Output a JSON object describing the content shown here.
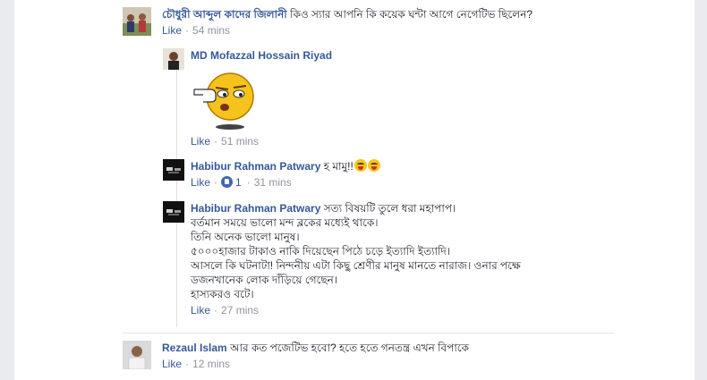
{
  "comments": [
    {
      "author": "চৌধুরী আব্দুল কাদের জিলানী",
      "text": "কিও স্যার আপনি কি কয়েক ঘন্টা আগে নেগেটিভ ছিলেন?",
      "like_label": "Like",
      "time": "54 mins"
    },
    {
      "author": "MD Mofazzal Hossain Riyad",
      "sticker": "thinking-emoji-sticker",
      "like_label": "Like",
      "time": "51 mins"
    },
    {
      "author": "Habibur Rahman Patwary",
      "text": "হ মামু!!",
      "emojis": [
        "grinning-tongue-emoji",
        "grinning-tongue-emoji"
      ],
      "like_label": "Like",
      "reaction_icon": "like-reaction-icon",
      "reaction_count": "1",
      "time": "31 mins"
    },
    {
      "author": "Habibur Rahman Patwary",
      "lines": [
        "সত্য বিষয়টি তুলে ধরা মহাপাপ।",
        "বর্তমান সময়ে ভালো মন্দ ব্লকের মধ্যেই থাকে।",
        "তিনি অনেক ভালো মানুষ।",
        "৫০০০হাজার টাকাও নাকি দিয়েছেন পিঠে চড়ে ইত্যাদি ইত্যাদি।",
        "আসলে কি ঘটনাটা! নিন্দনীয় এটা কিছু শ্রেণীর মানুষ মানতে নারাজ।  ওনার পক্ষে",
        "ডজনখানেক লোক দাঁড়িয়ে গেছেন।",
        "হাস্যকরও বটে।"
      ],
      "like_label": "Like",
      "time": "27 mins"
    },
    {
      "author": "Rezaul Islam",
      "text": "আর কত পজেটিভ হবো? হতে হতে গনতন্ত্র এখন বিপাকে",
      "like_label": "Like",
      "time": "12 mins"
    }
  ],
  "colors": {
    "link": "#365899",
    "meta": "#90949c",
    "text": "#1d2129"
  }
}
